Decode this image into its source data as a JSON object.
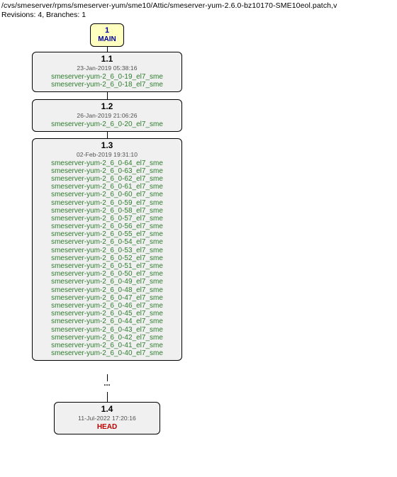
{
  "header": {
    "path": "/cvs/smeserver/rpms/smeserver-yum/sme10/Attic/smeserver-yum-2.6.0-bz10170-SME10eol.patch,v",
    "meta": "Revisions: 4, Branches: 1"
  },
  "nodes": {
    "main": {
      "num": "1",
      "branch": "MAIN"
    },
    "r11": {
      "rev": "1.1",
      "date": "23-Jan-2019 05:38:16",
      "tags": [
        "smeserver-yum-2_6_0-19_el7_sme",
        "smeserver-yum-2_6_0-18_el7_sme"
      ]
    },
    "r12": {
      "rev": "1.2",
      "date": "26-Jan-2019 21:06:26",
      "tags": [
        "smeserver-yum-2_6_0-20_el7_sme"
      ]
    },
    "r13": {
      "rev": "1.3",
      "date": "02-Feb-2019 19:31:10",
      "tags": [
        "smeserver-yum-2_6_0-64_el7_sme",
        "smeserver-yum-2_6_0-63_el7_sme",
        "smeserver-yum-2_6_0-62_el7_sme",
        "smeserver-yum-2_6_0-61_el7_sme",
        "smeserver-yum-2_6_0-60_el7_sme",
        "smeserver-yum-2_6_0-59_el7_sme",
        "smeserver-yum-2_6_0-58_el7_sme",
        "smeserver-yum-2_6_0-57_el7_sme",
        "smeserver-yum-2_6_0-56_el7_sme",
        "smeserver-yum-2_6_0-55_el7_sme",
        "smeserver-yum-2_6_0-54_el7_sme",
        "smeserver-yum-2_6_0-53_el7_sme",
        "smeserver-yum-2_6_0-52_el7_sme",
        "smeserver-yum-2_6_0-51_el7_sme",
        "smeserver-yum-2_6_0-50_el7_sme",
        "smeserver-yum-2_6_0-49_el7_sme",
        "smeserver-yum-2_6_0-48_el7_sme",
        "smeserver-yum-2_6_0-47_el7_sme",
        "smeserver-yum-2_6_0-46_el7_sme",
        "smeserver-yum-2_6_0-45_el7_sme",
        "smeserver-yum-2_6_0-44_el7_sme",
        "smeserver-yum-2_6_0-43_el7_sme",
        "smeserver-yum-2_6_0-42_el7_sme",
        "smeserver-yum-2_6_0-41_el7_sme",
        "smeserver-yum-2_6_0-40_el7_sme"
      ]
    },
    "r14": {
      "rev": "1.4",
      "date": "11-Jul-2022 17:20:16",
      "head": "HEAD"
    }
  },
  "ellipsis": "..."
}
